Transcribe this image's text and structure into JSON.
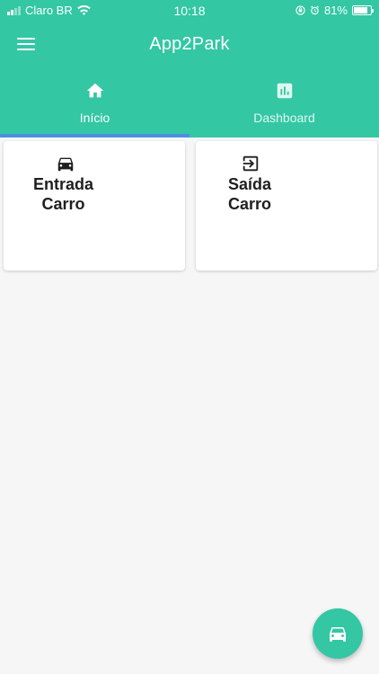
{
  "status_bar": {
    "carrier": "Claro BR",
    "time": "10:18",
    "battery": "81%",
    "battery_level": 0.81,
    "icons": [
      "signal-icon",
      "wifi-icon",
      "lock-rotation-icon",
      "alarm-icon",
      "battery-icon"
    ]
  },
  "app_bar": {
    "title": "App2Park",
    "menu_icon": "menu-icon"
  },
  "tabs": [
    {
      "label": "Início",
      "icon": "home-icon",
      "selected": true
    },
    {
      "label": "Dashboard",
      "icon": "bar-chart-icon",
      "selected": false
    }
  ],
  "cards": [
    {
      "line1": "Entrada",
      "line2": "Carro",
      "icon": "car-icon"
    },
    {
      "line1": "Saída",
      "line2": "Carro",
      "icon": "login-exit-icon"
    }
  ],
  "fab": {
    "icon": "car-icon"
  },
  "colors": {
    "primary": "#33c7a4",
    "tab_indicator": "#4a90e2",
    "background": "#f6f6f6",
    "card": "#ffffff",
    "text_dark": "#1f1f1f"
  }
}
